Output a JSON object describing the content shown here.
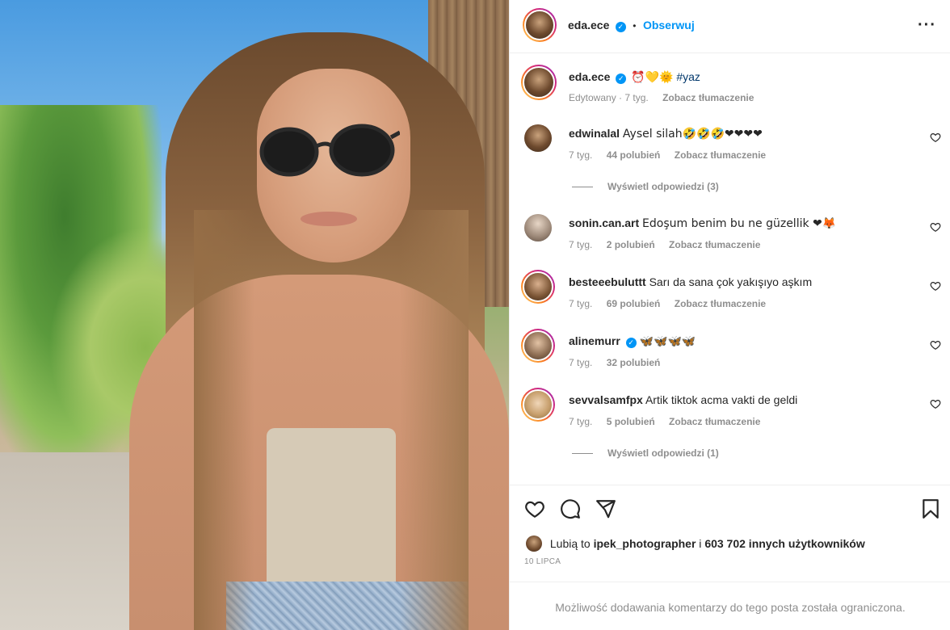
{
  "header": {
    "username": "eda.ece",
    "dot": "•",
    "follow_label": "Obserwuj",
    "more_icon": "more-horizontal-icon"
  },
  "caption": {
    "username": "eda.ece",
    "emojis": "⏰💛🌞",
    "hashtag": "#yaz",
    "edited": "Edytowany · 7 tyg.",
    "translate": "Zobacz tłumaczenie"
  },
  "comments": [
    {
      "username": "edwinalal",
      "text": "Aysel silah🤣🤣🤣❤❤❤❤",
      "age": "7 tyg.",
      "likes": "44 polubień",
      "translate": "Zobacz tłumaczenie",
      "replies": "Wyświetl odpowiedzi (3)"
    },
    {
      "username": "sonin.can.art",
      "text": "Edoşum benim bu ne güzellik ❤🦊",
      "age": "7 tyg.",
      "likes": "2 polubień",
      "translate": "Zobacz tłumaczenie"
    },
    {
      "username": "besteeebuluttt",
      "text": "Sarı da sana çok yakışıyo aşkım",
      "age": "7 tyg.",
      "likes": "69 polubień",
      "translate": "Zobacz tłumaczenie"
    },
    {
      "username": "alinemurr",
      "text": "🦋🦋🦋🦋",
      "age": "7 tyg.",
      "likes": "32 polubień"
    },
    {
      "username": "sevvalsamfpx",
      "text": "Artik tiktok acma vakti de geldi",
      "age": "7 tyg.",
      "likes": "5 polubień",
      "translate": "Zobacz tłumaczenie",
      "replies": "Wyświetl odpowiedzi (1)"
    }
  ],
  "likes": {
    "prefix": "Lubią to",
    "user": "ipek_photographer",
    "conj": "i",
    "others": "603 702 innych użytkowników"
  },
  "date": "10 LIPCA",
  "restricted": "Możliwość dodawania komentarzy do tego posta została ograniczona.",
  "icons": [
    "heart-icon",
    "comment-icon",
    "share-icon",
    "bookmark-icon"
  ],
  "colors": {
    "link": "#0095f6",
    "muted": "#8e8e8e",
    "hashtag": "#00376b"
  }
}
